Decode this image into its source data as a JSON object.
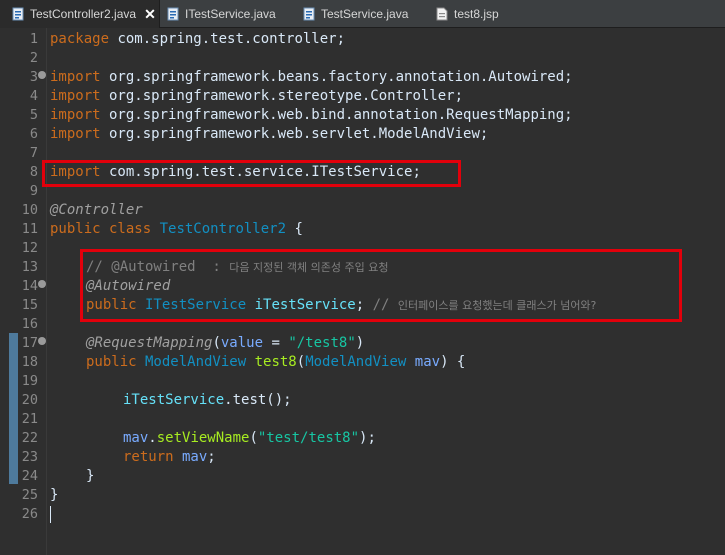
{
  "tabs": [
    {
      "label": "TestController2.java",
      "active": true,
      "close": "✕"
    },
    {
      "label": "ITestService.java",
      "active": false
    },
    {
      "label": "TestService.java",
      "active": false
    },
    {
      "label": "test8.jsp",
      "active": false
    }
  ],
  "gutter": {
    "line_numbers": [
      "1",
      "2",
      "3",
      "4",
      "5",
      "6",
      "7",
      "8",
      "9",
      "10",
      "11",
      "12",
      "13",
      "14",
      "15",
      "16",
      "17",
      "18",
      "19",
      "20",
      "21",
      "22",
      "23",
      "24",
      "25",
      "26"
    ],
    "folding_markers_at_lines": [
      3,
      14,
      17
    ]
  },
  "code": {
    "l1": {
      "kw": "package",
      "rest": " com.spring.test.controller;"
    },
    "l3": {
      "kw": "import",
      "rest": " org.springframework.beans.factory.annotation.Autowired;"
    },
    "l4": {
      "kw": "import",
      "rest": " org.springframework.stereotype.Controller;"
    },
    "l5": {
      "kw": "import",
      "rest": " org.springframework.web.bind.annotation.RequestMapping;"
    },
    "l6": {
      "kw": "import",
      "rest": " org.springframework.web.servlet.ModelAndView;"
    },
    "l8": {
      "kw": "import",
      "rest": " com.spring.test.service.ITestService;"
    },
    "l10": {
      "ann": "@Controller"
    },
    "l11": {
      "kw1": "public",
      "kw2": " class ",
      "type": "TestController2",
      "rest": " {"
    },
    "l13": {
      "comment": "// @Autowired  : ",
      "comment_ko": "다음 지정된 객체 의존성 주입 요청"
    },
    "l14": {
      "ann": "@Autowired"
    },
    "l15": {
      "kw": "public",
      "type": " ITestService ",
      "field": "iTestService",
      "semi": "; ",
      "comment": "// ",
      "comment_ko": "인터페이스를 요청했는데 클래스가 넘어와?"
    },
    "l17": {
      "ann": "@RequestMapping",
      "open": "(",
      "param": "value",
      "eq": " = ",
      "str": "\"/test8\"",
      "close": ")"
    },
    "l18": {
      "kw": "public",
      "type": " ModelAndView ",
      "method": "test8",
      "open": "(",
      "type2": "ModelAndView",
      "param": " mav",
      "close": ") {"
    },
    "l20": {
      "field": "iTestService",
      "rest": ".test();"
    },
    "l22": {
      "param": "mav",
      "dot": ".",
      "method": "setViewName",
      "open": "(",
      "str": "\"test/test8\"",
      "close": ");"
    },
    "l23": {
      "kw": "return",
      "param": " mav",
      "semi": ";"
    },
    "l24": {
      "text": "}"
    },
    "l25": {
      "text": "}"
    }
  },
  "colors": {
    "highlight_box": "#e2000b",
    "keyword": "#cc6c1d",
    "type": "#1290c3",
    "field": "#66e1f8",
    "string": "#17c6a3",
    "annotation": "#a0a0a0"
  }
}
